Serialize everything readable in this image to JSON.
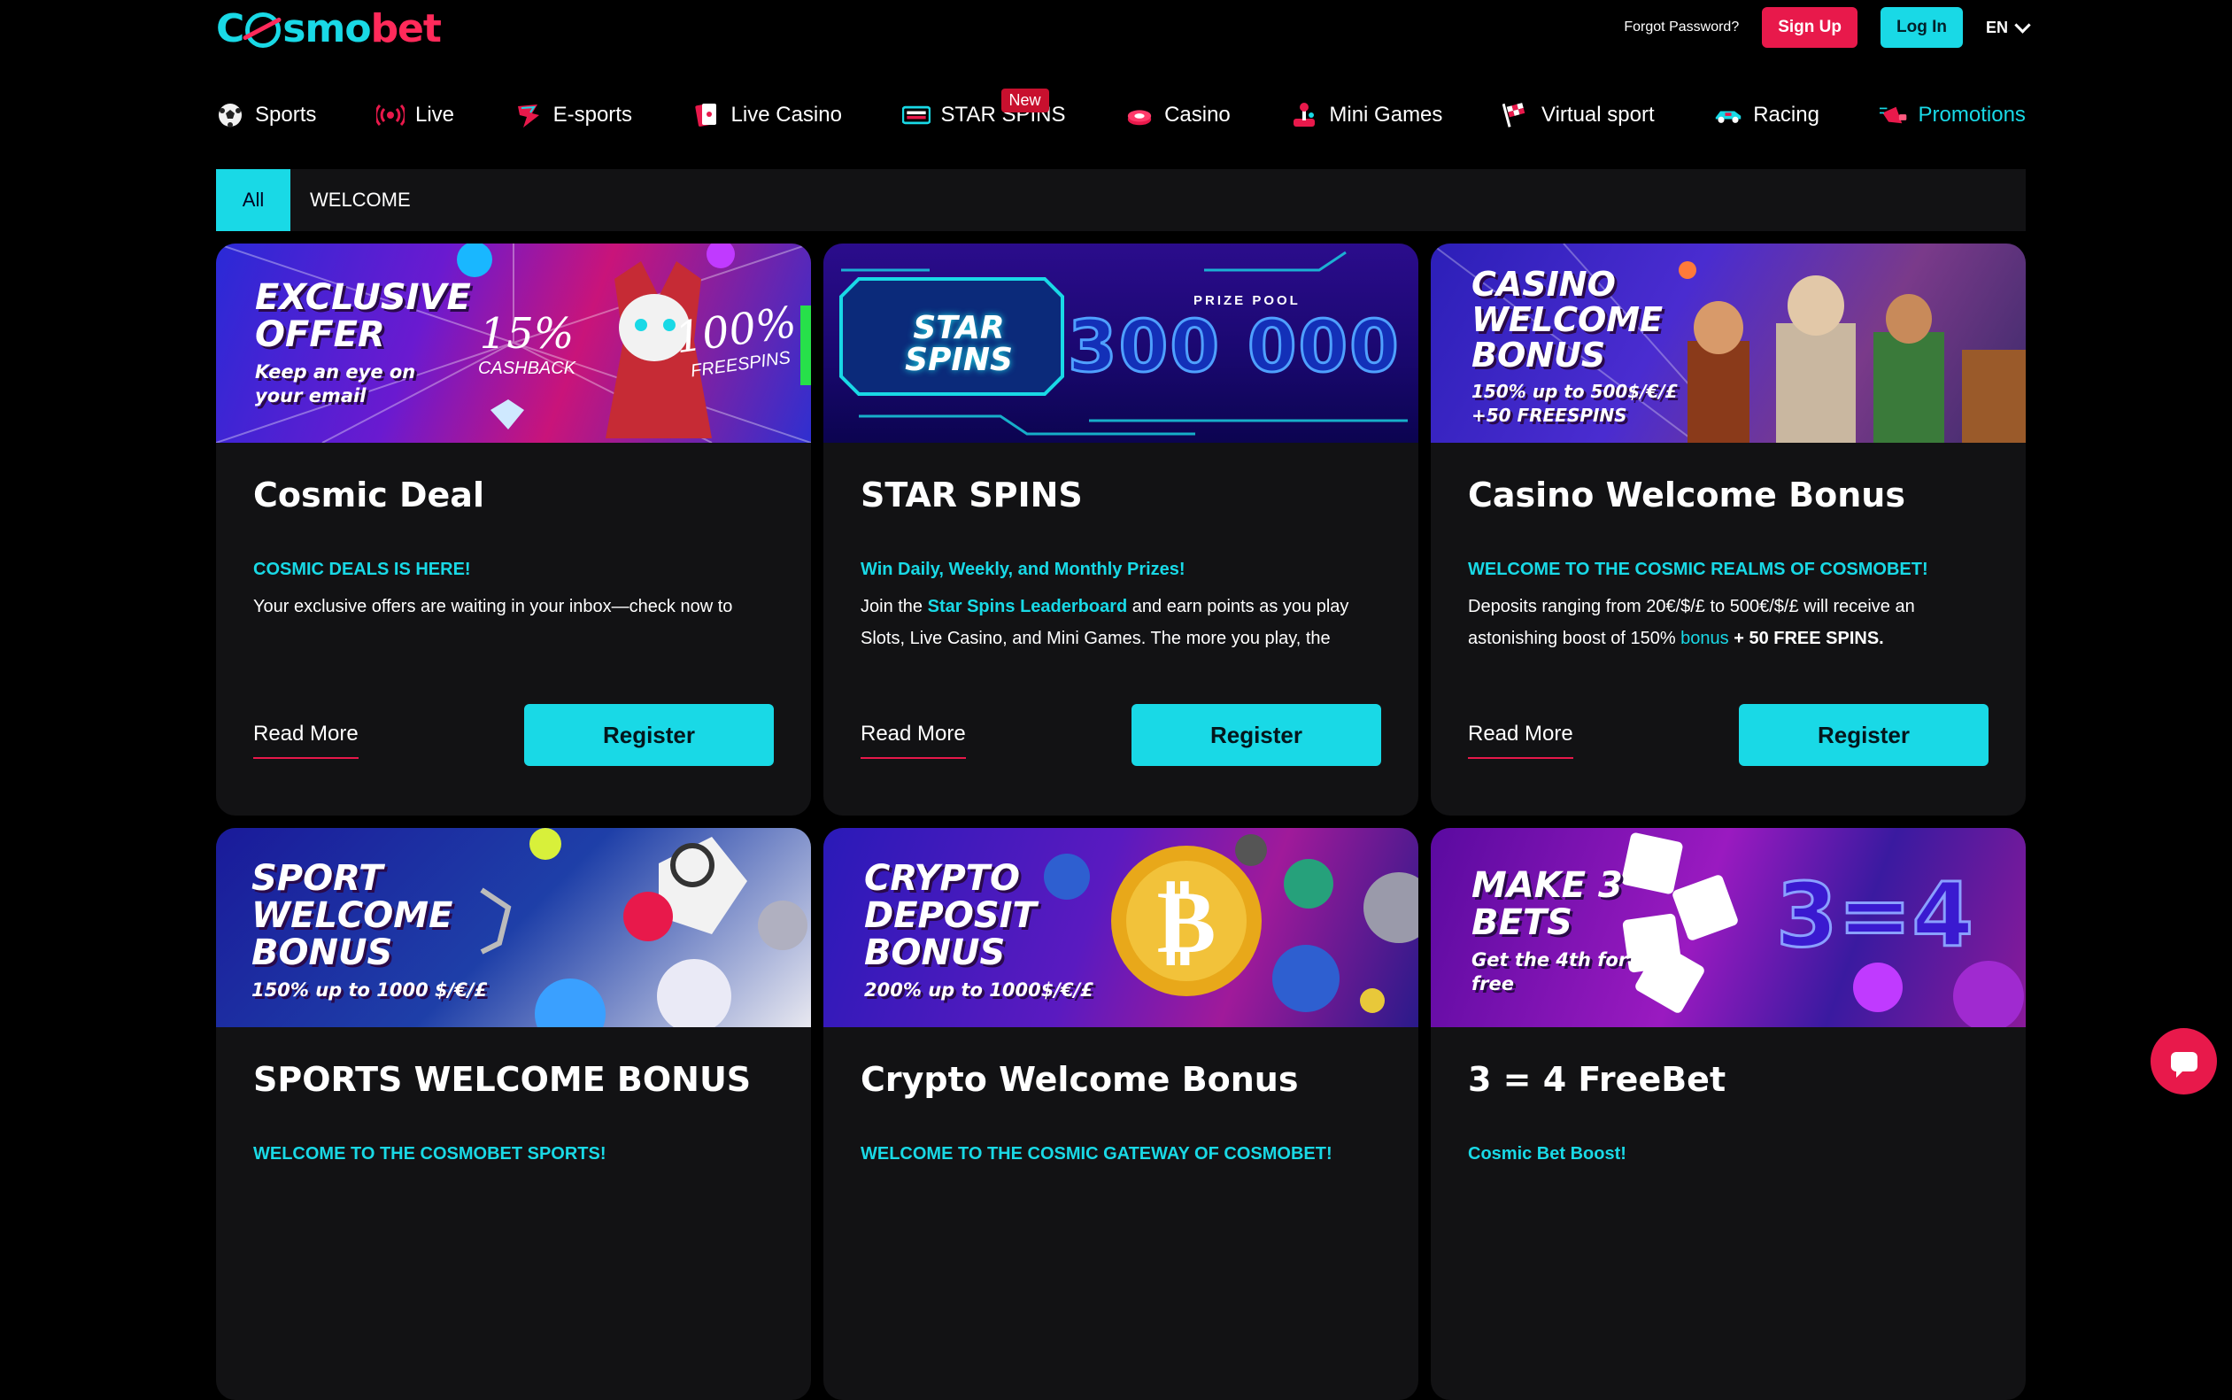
{
  "header": {
    "logo_text_a": "C",
    "logo_text_b": "smo",
    "logo_text_c": "bet",
    "forgot": "Forgot Password?",
    "signup": "Sign Up",
    "login": "Log In",
    "lang": "EN"
  },
  "nav": {
    "items": [
      {
        "label": "Sports",
        "icon": "soccer-ball-icon"
      },
      {
        "label": "Live",
        "icon": "live-signal-icon"
      },
      {
        "label": "E-sports",
        "icon": "esports-icon"
      },
      {
        "label": "Live Casino",
        "icon": "cards-icon"
      },
      {
        "label": "STAR SPINS",
        "icon": "star-spins-icon",
        "badge": "New"
      },
      {
        "label": "Casino",
        "icon": "casino-chips-icon"
      },
      {
        "label": "Mini Games",
        "icon": "joystick-icon"
      },
      {
        "label": "Virtual sport",
        "icon": "checkered-flag-icon"
      },
      {
        "label": "Racing",
        "icon": "race-car-icon"
      },
      {
        "label": "Promotions",
        "icon": "megaphone-icon"
      }
    ]
  },
  "filter": {
    "all": "All",
    "welcome": "WELCOME"
  },
  "cards": [
    {
      "banner_title": "Exclusive Offer",
      "banner_sub": "Keep an eye on your email",
      "banner_extra_a": "15%",
      "banner_extra_a_sub": "CASHBACK",
      "banner_extra_b": "100%",
      "banner_extra_b_sub": "FREESPINS",
      "title": "Cosmic Deal",
      "subtitle": "COSMIC DEALS IS HERE!",
      "body": "Your exclusive offers are waiting in your inbox—check now to",
      "read_more": "Read More",
      "register": "Register"
    },
    {
      "banner_title": "STAR SPINS",
      "banner_pool_label": "PRIZE POOL",
      "banner_pool_value": "300 000",
      "title": "STAR SPINS",
      "subtitle": "Win Daily, Weekly, and Monthly Prizes!",
      "body_a": "Join the ",
      "body_link": "Star Spins Leaderboard",
      "body_b": " and earn points as you play Slots, Live Casino, and Mini Games. The more you play, the",
      "read_more": "Read More",
      "register": "Register"
    },
    {
      "banner_title": "Casino Welcome Bonus",
      "banner_sub": "150% up to 500$/€/£ +50 FREESPINS",
      "title": "Casino Welcome Bonus",
      "subtitle": "WELCOME TO THE COSMIC REALMS OF COSMOBET!",
      "body_a": "Deposits ranging from 20€/$/£ to 500€/$/£ will receive an astonishing boost of 150% ",
      "body_link": "bonus",
      "body_b": "  + 50 FREE SPINS.",
      "read_more": "Read More",
      "register": "Register"
    },
    {
      "banner_title": "Sport Welcome Bonus",
      "banner_sub": "150% up to 1000 $/€/£",
      "title": "SPORTS WELCOME BONUS",
      "subtitle": "WELCOME TO THE COSMOBET SPORTS!"
    },
    {
      "banner_title": "Crypto Deposit Bonus",
      "banner_sub": "200% up to 1000$/€/£",
      "title": "Crypto Welcome Bonus",
      "subtitle": "WELCOME TO THE COSMIC GATEWAY OF COSMOBET!"
    },
    {
      "banner_title": "Make 3 Bets",
      "banner_sub": "Get the 4th for free",
      "banner_extra_a": "3=4",
      "title": "3 = 4 FreeBet",
      "subtitle": "Cosmic Bet Boost!"
    }
  ],
  "colors": {
    "accent": "#19d9e6",
    "brand_red": "#e8194b",
    "card_bg": "#121214",
    "page_bg": "#000000"
  }
}
